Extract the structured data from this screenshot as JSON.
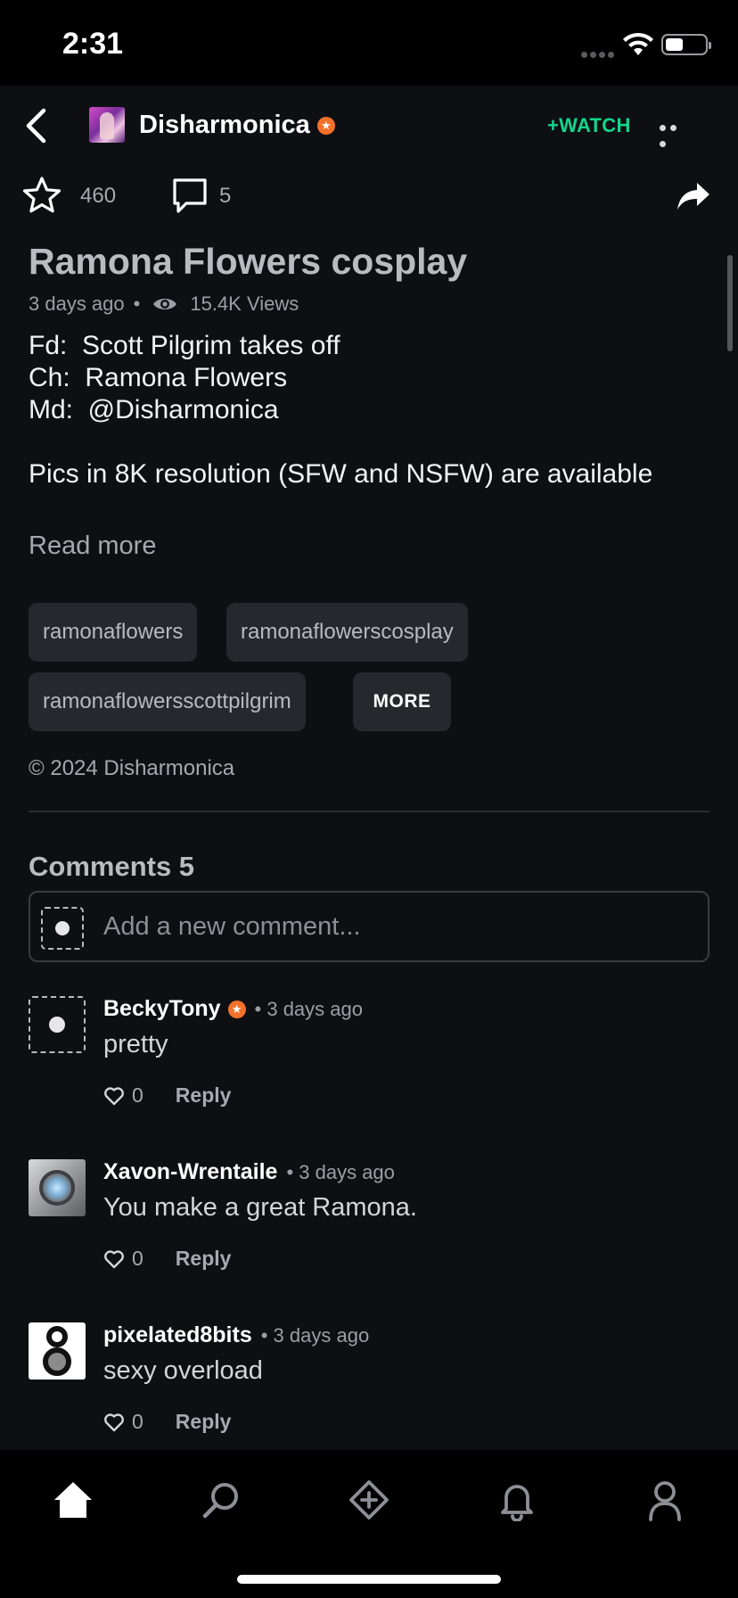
{
  "status_bar": {
    "time": "2:31",
    "battery_level": 0.45
  },
  "header": {
    "username": "Disharmonica",
    "watch_label": "+WATCH"
  },
  "actions": {
    "favorites": "460",
    "comments": "5"
  },
  "post": {
    "title": "Ramona Flowers cosplay",
    "posted": "3 days ago",
    "views": "15.4K Views",
    "description_lines": [
      "Fd:  Scott Pilgrim takes off",
      "Ch:  Ramona Flowers",
      "Md:  @Disharmonica",
      "",
      "Pics in 8K resolution (SFW and NSFW) are available"
    ],
    "read_more": "Read more",
    "tags": [
      "ramonaflowers",
      "ramonaflowerscosplay",
      "ramonaflowersscottpilgrim"
    ],
    "more_tags_label": "MORE",
    "copyright": "© 2024 Disharmonica"
  },
  "comments_section": {
    "heading": "Comments 5",
    "input_placeholder": "Add a new comment...",
    "items": [
      {
        "author": "BeckyTony",
        "time": "• 3 days ago",
        "text": "pretty",
        "likes": "0",
        "reply_label": "Reply"
      },
      {
        "author": "Xavon-Wrentaile",
        "time": "• 3 days ago",
        "text": "You make a great Ramona.",
        "likes": "0",
        "reply_label": "Reply"
      },
      {
        "author": "pixelated8bits",
        "time": "• 3 days ago",
        "text": "sexy overload",
        "likes": "0",
        "reply_label": "Reply"
      }
    ]
  },
  "tab_bar": {
    "icons": [
      "home-icon",
      "search-icon",
      "create-icon",
      "notifications-icon",
      "profile-icon"
    ]
  },
  "colors": {
    "accent": "#12d68b",
    "badge": "#f4712a",
    "background": "#0e0f13"
  }
}
